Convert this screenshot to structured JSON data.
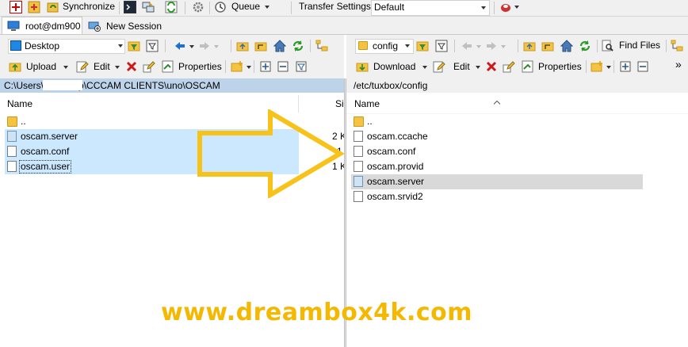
{
  "toolbar1": {
    "synchronize": "Synchronize",
    "queue": "Queue",
    "transfer_settings_label": "Transfer Settings",
    "transfer_settings_value": "Default"
  },
  "tabs": [
    {
      "label": "root@dm900"
    },
    {
      "label": "New Session"
    }
  ],
  "left": {
    "location": "Desktop",
    "upload": "Upload",
    "edit": "Edit",
    "properties": "Properties",
    "path": "C:\\Users\\        \\Desktop\\CCCAM CLIENTS\\uno\\OSCAM",
    "col_name": "Name",
    "col_size": "Si",
    "files": [
      {
        "name": "..",
        "size": ""
      },
      {
        "name": "oscam.server",
        "size": "2 K"
      },
      {
        "name": "oscam.conf",
        "size": "1"
      },
      {
        "name": "oscam.user",
        "size": "1 K"
      }
    ]
  },
  "right": {
    "location": "config",
    "find_files": "Find Files",
    "download": "Download",
    "edit": "Edit",
    "properties": "Properties",
    "more": "»",
    "path": "/etc/tuxbox/config",
    "col_name": "Name",
    "files": [
      {
        "name": ".."
      },
      {
        "name": "oscam.ccache"
      },
      {
        "name": "oscam.conf"
      },
      {
        "name": "oscam.provid"
      },
      {
        "name": "oscam.server"
      },
      {
        "name": "oscam.srvid2"
      }
    ]
  },
  "watermark": "www.dreambox4k.com",
  "colors": {
    "arrow": "#f7c21a",
    "watermark": "#f5b800",
    "selection": "#cce8ff",
    "path_bar": "#bcd3ea"
  }
}
